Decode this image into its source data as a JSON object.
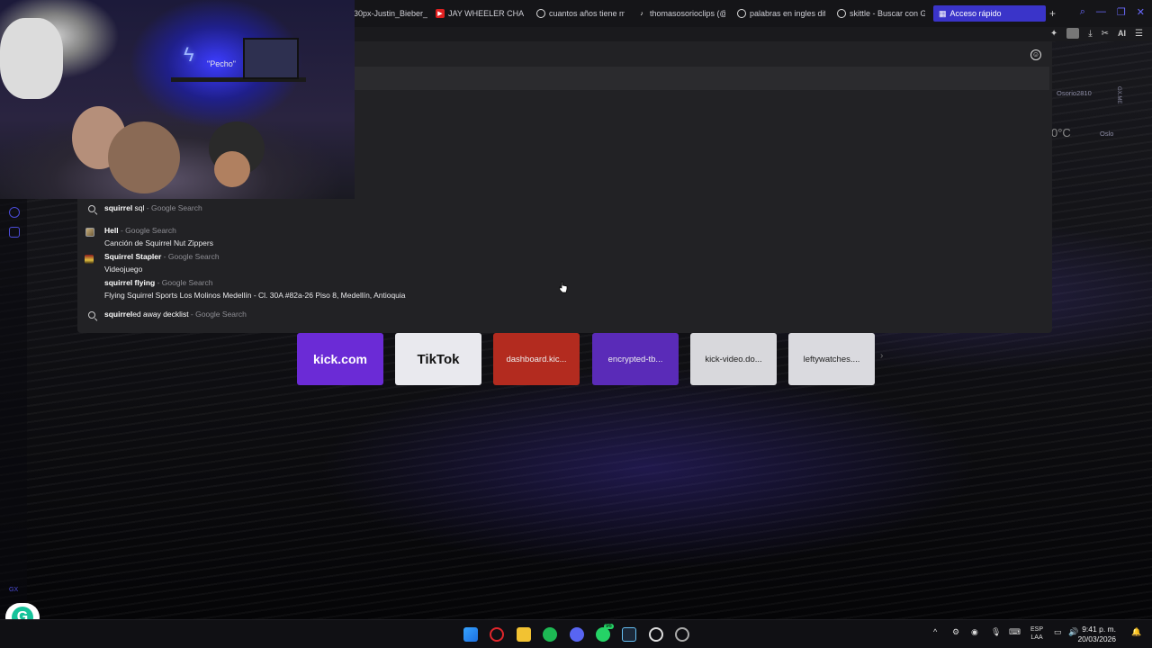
{
  "tabs": [
    {
      "label": "30px-Justin_Bieber_",
      "icon": "page-icon"
    },
    {
      "label": "JAY WHEELER CHARL",
      "icon": "youtube-icon",
      "color": "#e02020"
    },
    {
      "label": "cuantos años tiene m",
      "icon": "google-icon"
    },
    {
      "label": "thomasosorioclips (@",
      "icon": "tiktok-icon"
    },
    {
      "label": "palabras en ingles difi",
      "icon": "google-icon"
    },
    {
      "label": "skittle - Buscar con G",
      "icon": "google-icon"
    },
    {
      "label": "Acceso rápido",
      "icon": "grid-icon",
      "active": true
    }
  ],
  "toolbar": {
    "ai_label": "AI"
  },
  "omnibox": {
    "suggestions": [
      {
        "bold": "squirrel",
        "rest": " sql",
        "source": "Google Search",
        "sub": "",
        "icon": "search-icon"
      },
      {
        "bold": "Hell",
        "rest": "",
        "source": "Google Search",
        "sub": "Canción de Squirrel Nut Zippers",
        "icon": "album-thumbnail"
      },
      {
        "bold": "Squirrel Stapler",
        "rest": "",
        "source": "Google Search",
        "sub": "Videojuego",
        "icon": "game-thumbnail"
      },
      {
        "bold": "squirrel flying",
        "rest": "",
        "source": "Google Search",
        "sub": "Flying Squirrel Sports Los Molinos Medellín - Cl. 30A #82a-26 Piso 8, Medellín, Antioquia",
        "icon": "none"
      },
      {
        "bold": "squirrel",
        "rest": "ed away decklist",
        "source": "Google Search",
        "sub": "",
        "icon": "search-icon"
      }
    ],
    "separator": " - "
  },
  "speed_dials": [
    {
      "label": "kick.com",
      "color": "#6b2bd6"
    },
    {
      "label": "TikTok",
      "color": "#e9e9ee"
    },
    {
      "label": "dashboard.kic...",
      "color": "#b32b1f"
    },
    {
      "label": "encrypted-tb...",
      "color": "#5a2bb8"
    },
    {
      "label": "kick-video.do...",
      "color": "#d8d8dc"
    },
    {
      "label": "leftywatches....",
      "color": "#dadadf"
    }
  ],
  "right_widgets": {
    "user": "Osorio2810",
    "gx_label": "GX.ME",
    "temp": "0°C",
    "city": "Oslo"
  },
  "webcam": {
    "sign_text": "\"Pecho\""
  },
  "leftbar": {
    "gx": "GX"
  },
  "taskbar": {
    "whatsapp_badge": "96",
    "lang_top": "ESP",
    "lang_bottom": "LAA",
    "time": "9:41 p. m.",
    "date": "20/03/2026"
  },
  "colors": {
    "accent": "#3a34c9",
    "tab_bar": "#151518",
    "omnibox": "#222225"
  }
}
